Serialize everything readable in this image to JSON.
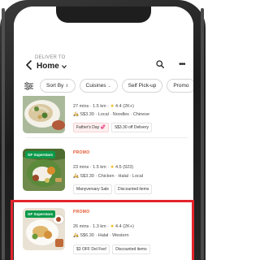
{
  "header": {
    "deliver_to": "DELIVER TO",
    "location": "Home",
    "location_chevron": "chevron-down-icon",
    "back_icon": "back-arrow-icon",
    "search_icon": "search-icon",
    "more_icon": "more-icon"
  },
  "filters": {
    "icon": "filter-icon",
    "chips": [
      {
        "label": "Sort By",
        "arrow": "⇕"
      },
      {
        "label": "Cuisines",
        "arrow": "⌄"
      },
      {
        "label": "Self Pick-up",
        "arrow": ""
      },
      {
        "label": "Promo",
        "arrow": ""
      }
    ]
  },
  "listings": [
    {
      "time": "27 mins",
      "distance": "1.5 km",
      "rating": "4.4",
      "reviews": "(2K+)",
      "delivery_fee": "S$3.30",
      "categories": "Local · Noodles · Chinese",
      "tags": [
        "Father's Day 💞",
        "S$3.30 off Delivery"
      ]
    },
    {
      "badge": "GF Superstars",
      "promo": "PROMO",
      "time": "23 mins",
      "distance": "1.5 km",
      "rating": "4.5",
      "reviews": "(923)",
      "delivery_fee": "S$3.30",
      "categories": "Chicken · Halal · Local",
      "tags": [
        "Manyversary Sale",
        "Discounted items"
      ]
    },
    {
      "badge": "GF Superstars",
      "promo": "PROMO",
      "time": "26 mins",
      "distance": "1.3 km",
      "rating": "4.4",
      "reviews": "(2K+)",
      "delivery_fee": "S$6.30",
      "categories": "Halal · Western",
      "tags": [
        "$3 OFF Del Fee!",
        "Discounted items"
      ]
    }
  ],
  "colors": {
    "highlight": "#e3242b",
    "promo": "#e4572e",
    "badge": "#0a9a4a",
    "star": "#f4b400"
  }
}
